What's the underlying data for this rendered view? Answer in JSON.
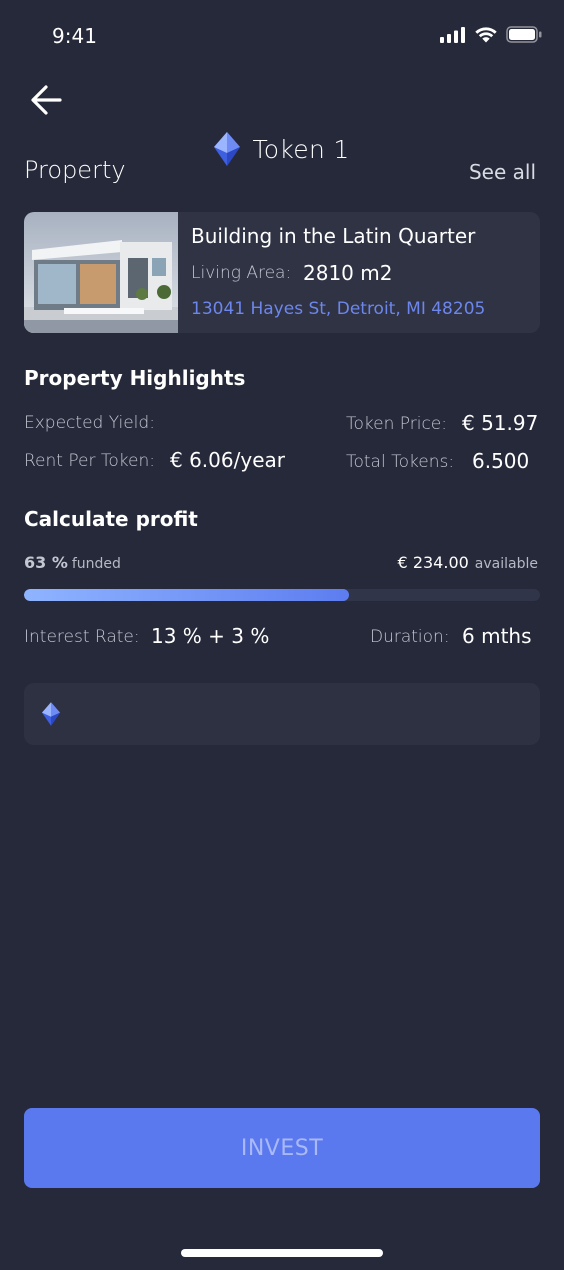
{
  "status": {
    "time": "9:41"
  },
  "header": {
    "token_name": "Token 1"
  },
  "property": {
    "section_title": "Property",
    "see_all": "See all",
    "title": "Building in the Latin Quarter",
    "living_area_label": "Living Area:",
    "living_area_value": "2810 m2",
    "address": "13041 Hayes St, Detroit, MI 48205"
  },
  "highlights": {
    "title": "Property Highlights",
    "expected_yield_label": "Expected Yield:",
    "token_price_label": "Token Price:",
    "token_price_value": "€ 51.97",
    "rent_per_token_label": "Rent Per Token:",
    "rent_per_token_value": "€ 6.06/year",
    "total_tokens_label": "Total Tokens:",
    "total_tokens_value": "6.500"
  },
  "profit": {
    "title": "Calculate profit",
    "funded_percent": "63 %",
    "funded_label": "funded",
    "funded_fraction": 0.63,
    "available_amount": "€ 234.00",
    "available_label": "available",
    "interest_rate_label": "Interest Rate:",
    "interest_rate_value": "13 % + 3 %",
    "duration_label": "Duration:",
    "duration_value": "6 mths"
  },
  "invest_button": "INVEST",
  "colors": {
    "background": "#262939",
    "accent": "#5b79ee",
    "link": "#6d86ec"
  }
}
